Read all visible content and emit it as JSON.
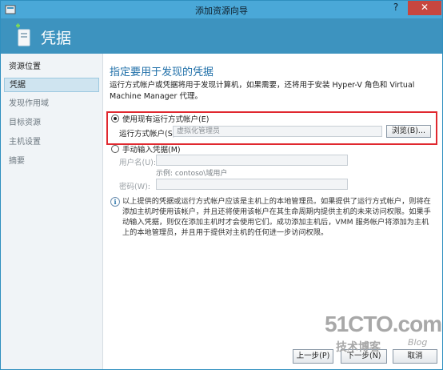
{
  "window": {
    "title": "添加资源向导",
    "help": "?",
    "close": "✕"
  },
  "header": {
    "title": "凭据"
  },
  "sidebar": {
    "items": [
      {
        "label": "资源位置",
        "state": "done"
      },
      {
        "label": "凭据",
        "state": "active"
      },
      {
        "label": "发现作用域",
        "state": "pending"
      },
      {
        "label": "目标资源",
        "state": "pending"
      },
      {
        "label": "主机设置",
        "state": "pending"
      },
      {
        "label": "摘要",
        "state": "pending"
      }
    ]
  },
  "main": {
    "section_title": "指定要用于发现的凭据",
    "description": "运行方式帐户或凭据将用于发现计算机，如果需要，还将用于安装 Hyper-V 角色和 Virtual Machine Manager 代理。",
    "option_existing": {
      "label": "使用现有运行方式帐户(E)",
      "selected": true
    },
    "runas_label": "运行方式帐户(S):",
    "runas_value": "虚拟化管理员",
    "browse_label": "浏览(B)...",
    "option_manual": {
      "label": "手动输入凭据(M)",
      "selected": false
    },
    "username_label": "用户名(U):",
    "username_hint": "示例: contoso\\域用户",
    "password_label": "密码(W):",
    "info_note": "以上提供的凭据或运行方式帐户应该是主机上的本地管理员。如果提供了运行方式帐户，则将在添加主机时使用该帐户，并且还将使用该帐户在其生命周期内提供主机的未来访问权限。如果手动输入凭据，则仅在添加主机时才会使用它们。成功添加主机后，VMM 服务帐户将添加为主机上的本地管理员，并且用于提供对主机的任何进一步访问权限。"
  },
  "footer": {
    "prev": "上一步(P)",
    "next": "下一步(N)",
    "cancel": "取消"
  },
  "watermark": {
    "site": "51CTO.com",
    "text": "技术博客",
    "blog": "Blog"
  },
  "colors": {
    "titlebar": "#4aa8d8",
    "header": "#3d93bf",
    "highlight": "#e0282f",
    "close": "#c7463f"
  }
}
